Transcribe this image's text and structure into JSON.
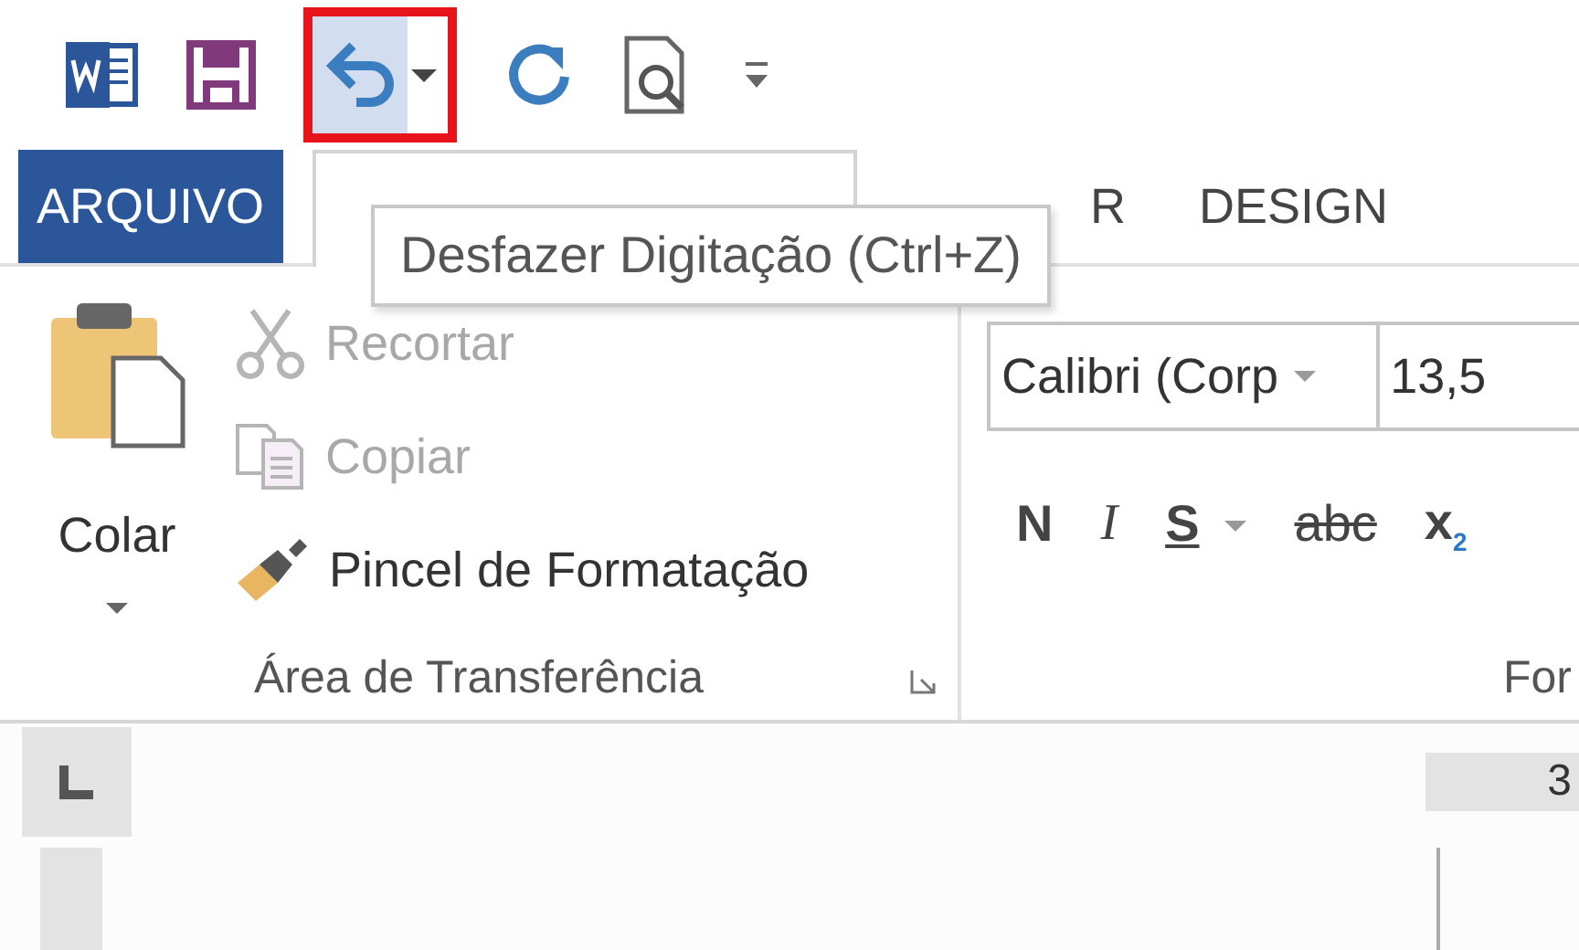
{
  "quick_access": {
    "buttons": [
      {
        "kind": "app",
        "highlighted": false
      },
      {
        "kind": "save",
        "highlighted": false
      },
      {
        "kind": "undo",
        "highlighted": true
      },
      {
        "kind": "redo",
        "highlighted": false
      },
      {
        "kind": "preview",
        "highlighted": false
      },
      {
        "kind": "customize",
        "highlighted": false
      }
    ]
  },
  "tabs": [
    {
      "kind": "file",
      "label": "ARQUIVO",
      "selected": false
    },
    {
      "kind": "tab",
      "selected": true
    },
    {
      "kind": "tab",
      "label": "R",
      "selected": false
    },
    {
      "kind": "tab",
      "label": "DESIGN",
      "selected": false
    }
  ],
  "tooltip": {
    "text": "Desfazer Digitação (Ctrl+Z)"
  },
  "clipboard": {
    "paste_label": "Colar",
    "items": [
      {
        "kind": "cut",
        "label": "Recortar",
        "disabled": true
      },
      {
        "kind": "copy",
        "label": "Copiar",
        "disabled": true
      },
      {
        "kind": "painter",
        "label": "Pincel de Formatação",
        "disabled": false
      }
    ],
    "group_label": "Área de Transferência"
  },
  "font": {
    "font_name": "Calibri (Corp",
    "font_size": "13,5",
    "buttons": [
      {
        "kind": "bold",
        "label": "N"
      },
      {
        "kind": "italic",
        "label": "I"
      },
      {
        "kind": "underline",
        "label": "S"
      },
      {
        "kind": "dropdown"
      },
      {
        "kind": "strike",
        "label": "abc"
      },
      {
        "kind": "subscript",
        "label": "x$_{2}$"
      }
    ],
    "group_label": "For"
  },
  "ruler": {
    "number": "3"
  }
}
